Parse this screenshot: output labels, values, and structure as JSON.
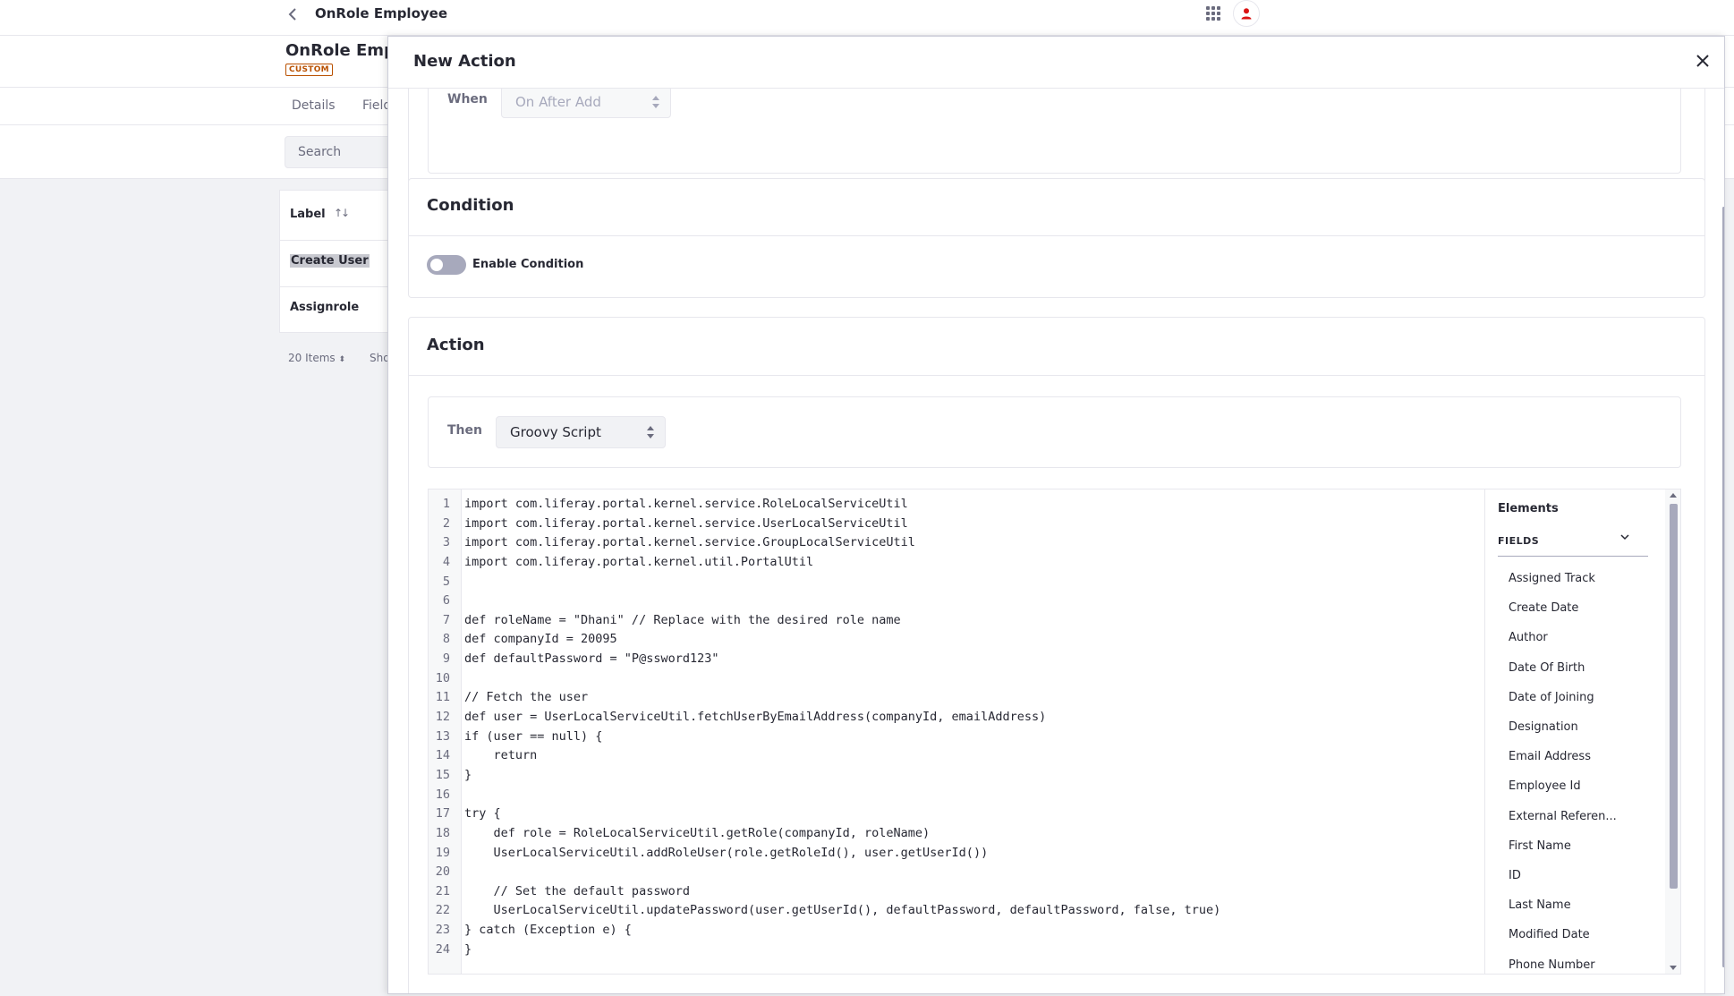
{
  "topbar": {
    "app_title": "OnRole Employee"
  },
  "object": {
    "title": "OnRole Emp",
    "badge": "CUSTOM"
  },
  "tabs": [
    {
      "label": "Details"
    },
    {
      "label": "Field"
    }
  ],
  "search": {
    "placeholder": "Search"
  },
  "table": {
    "header": "Label",
    "rows": [
      {
        "label": "Create User"
      },
      {
        "label": "Assignrole"
      }
    ]
  },
  "pagination": {
    "items": "20 Items",
    "show": "Sho"
  },
  "modal": {
    "title": "New Action",
    "when": {
      "label": "When",
      "value": "On After Add"
    },
    "condition": {
      "title": "Condition",
      "toggle_label": "Enable Condition",
      "enabled": false
    },
    "action": {
      "title": "Action",
      "then": {
        "label": "Then",
        "value": "Groovy Script"
      }
    },
    "code_lines": [
      "import com.liferay.portal.kernel.service.RoleLocalServiceUtil",
      "import com.liferay.portal.kernel.service.UserLocalServiceUtil",
      "import com.liferay.portal.kernel.service.GroupLocalServiceUtil",
      "import com.liferay.portal.kernel.util.PortalUtil",
      "",
      "",
      "def roleName = \"Dhani\" // Replace with the desired role name",
      "def companyId = 20095",
      "def defaultPassword = \"P@ssword123\"",
      "",
      "// Fetch the user",
      "def user = UserLocalServiceUtil.fetchUserByEmailAddress(companyId, emailAddress)",
      "if (user == null) {",
      "    return",
      "}",
      "",
      "try {",
      "    def role = RoleLocalServiceUtil.getRole(companyId, roleName)",
      "    UserLocalServiceUtil.addRoleUser(role.getRoleId(), user.getUserId())",
      "",
      "    // Set the default password",
      "    UserLocalServiceUtil.updatePassword(user.getUserId(), defaultPassword, defaultPassword, false, true)",
      "} catch (Exception e) {",
      "}"
    ],
    "elements": {
      "title": "Elements",
      "section": "FIELDS",
      "fields": [
        "Assigned Track",
        "Create Date",
        "Author",
        "Date Of Birth",
        "Date of Joining",
        "Designation",
        "Email Address",
        "Employee Id",
        "External Referen...",
        "First Name",
        "ID",
        "Last Name",
        "Modified Date",
        "Phone Number"
      ]
    }
  },
  "colors": {
    "accent": "#0b5fff",
    "avatar": "#da1414",
    "badge": "#b95000"
  }
}
